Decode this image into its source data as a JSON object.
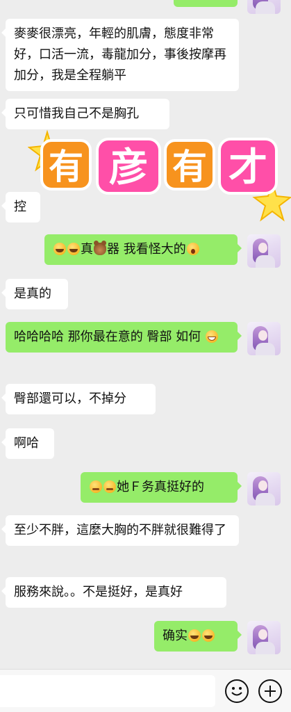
{
  "messages": [
    {
      "side": "in",
      "text": "麥麥很漂亮，年輕的肌膚，態度非常好，口活一流，毒龍加分，事後按摩再加分，我是全程躺平"
    },
    {
      "side": "in",
      "text": "只可惜我自己不是胸孔"
    },
    {
      "side": "in",
      "text": "控"
    },
    {
      "side": "out",
      "text_a": "真",
      "text_b": "器 我看怪大的",
      "emoji": [
        "rofl-emoji",
        "rofl-emoji",
        "bear-emoji",
        "shock-emoji"
      ]
    },
    {
      "side": "in",
      "text": "是真的"
    },
    {
      "side": "out",
      "text": "哈哈哈哈 那你最在意的 臀部 如何",
      "emoji": [
        "grin-emoji"
      ]
    },
    {
      "side": "in",
      "text": "臀部還可以，不掉分"
    },
    {
      "side": "in",
      "text": "啊哈"
    },
    {
      "side": "out",
      "text": "她Ｆ务真挺好的",
      "emoji": [
        "thinking-emoji",
        "thinking-emoji"
      ]
    },
    {
      "side": "in",
      "text": "至少不胖，這麼大胸的不胖就很難得了"
    },
    {
      "side": "in",
      "text": "服務來說。。不是挺好，是真好"
    },
    {
      "side": "out",
      "text": "确实",
      "emoji": [
        "joy-emoji",
        "joy-emoji"
      ]
    }
  ],
  "sticker": {
    "chars": [
      "有",
      "彦",
      "有",
      "才"
    ],
    "colors": {
      "orange": "#f7931e",
      "pink": "#ff4fa8",
      "star": "#ffe14a"
    }
  },
  "input_bar": {
    "value": "",
    "emoji_button_icon": "smiley-icon",
    "plus_button_icon": "plus-circle-icon"
  },
  "colors": {
    "background": "#ededed",
    "incoming_bubble": "#ffffff",
    "outgoing_bubble": "#95ec69"
  }
}
